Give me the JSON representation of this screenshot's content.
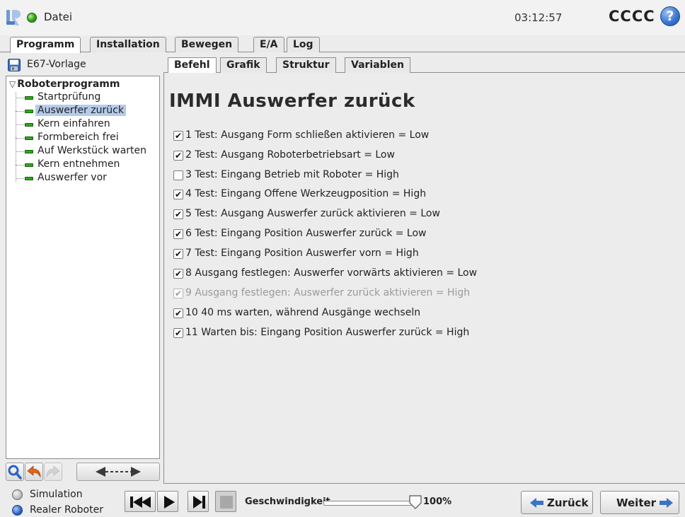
{
  "header": {
    "file_menu_label": "Datei",
    "clock": "03:12:57",
    "robot_name": "CCCC",
    "help_symbol": "?"
  },
  "main_tabs": [
    {
      "label": "Programm",
      "active": true
    },
    {
      "label": "Installation",
      "active": false
    },
    {
      "label": "Bewegen",
      "active": false
    },
    {
      "label": "E/A",
      "active": false
    },
    {
      "label": "Log",
      "active": false
    }
  ],
  "program": {
    "name": "E67-Vorlage",
    "root": "Roboterprogramm",
    "items": [
      {
        "label": "Startprüfung",
        "selected": false
      },
      {
        "label": "Auswerfer zurück",
        "selected": true
      },
      {
        "label": "Kern einfahren",
        "selected": false
      },
      {
        "label": "Formbereich frei",
        "selected": false
      },
      {
        "label": "Auf Werkstück warten",
        "selected": false
      },
      {
        "label": "Kern entnehmen",
        "selected": false
      },
      {
        "label": "Auswerfer vor",
        "selected": false
      }
    ]
  },
  "sub_tabs": [
    {
      "label": "Befehl",
      "active": true
    },
    {
      "label": "Grafik",
      "active": false
    },
    {
      "label": "Struktur",
      "active": false
    },
    {
      "label": "Variablen",
      "active": false
    }
  ],
  "command": {
    "title": "IMMI Auswerfer zurück",
    "lines": [
      {
        "text": "1 Test: Ausgang Form schließen aktivieren = Low",
        "checked": true,
        "disabled": false
      },
      {
        "text": "2 Test: Ausgang Roboterbetriebsart = Low",
        "checked": true,
        "disabled": false
      },
      {
        "text": "3 Test: Eingang Betrieb mit Roboter = High",
        "checked": false,
        "disabled": false
      },
      {
        "text": "4 Test: Eingang Offene Werkzeugposition = High",
        "checked": true,
        "disabled": false
      },
      {
        "text": "5 Test: Ausgang Auswerfer zurück aktivieren = Low",
        "checked": true,
        "disabled": false
      },
      {
        "text": "6 Test: Eingang Position Auswerfer zurück = Low",
        "checked": true,
        "disabled": false
      },
      {
        "text": "7 Test: Eingang Position Auswerfer vorn = High",
        "checked": true,
        "disabled": false
      },
      {
        "text": "8 Ausgang festlegen: Auswerfer vorwärts aktivieren = Low",
        "checked": true,
        "disabled": false
      },
      {
        "text": "9 Ausgang festlegen: Auswerfer zurück aktivieren = High",
        "checked": true,
        "disabled": true
      },
      {
        "text": "10 40 ms warten, während Ausgänge wechseln",
        "checked": true,
        "disabled": false
      },
      {
        "text": "11 Warten bis: Eingang Position Auswerfer zurück = High",
        "checked": true,
        "disabled": false
      }
    ]
  },
  "footer": {
    "modes": [
      {
        "label": "Simulation",
        "selected": false
      },
      {
        "label": "Realer Roboter",
        "selected": true
      }
    ],
    "speed_label": "Geschwindigkeit",
    "speed_value": "100%",
    "speed_fraction": 1.0,
    "back_label": "Zurück",
    "next_label": "Weiter"
  },
  "colors": {
    "accent_blue": "#3c78d4",
    "node_green": "#2fa81c",
    "selection": "#b5cbea",
    "nav_arrow": "#3a73c9"
  }
}
